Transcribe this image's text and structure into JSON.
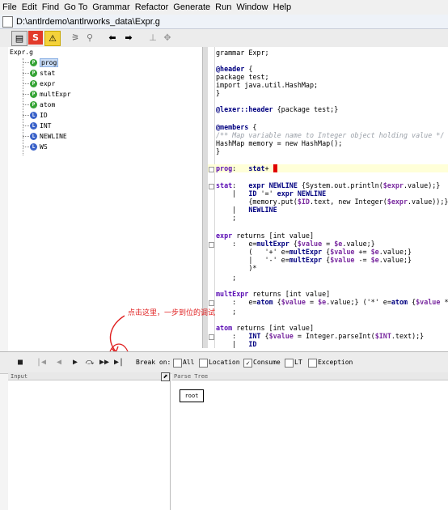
{
  "menu": [
    "File",
    "Edit",
    "Find",
    "Go To",
    "Grammar",
    "Refactor",
    "Generate",
    "Run",
    "Window",
    "Help"
  ],
  "window": {
    "title": "D:\\antlrdemo\\antlrworks_data\\Expr.g"
  },
  "toolbar": {
    "icons": [
      "editor-icon",
      "stop-s-icon",
      "warning-icon",
      "tree-icon",
      "search-icon",
      "back-arrow-icon",
      "forward-arrow-icon",
      "split-icon",
      "split-disabled-icon"
    ]
  },
  "tree": {
    "root": "Expr.g",
    "items": [
      {
        "label": "prog",
        "kind": "P",
        "selected": true
      },
      {
        "label": "stat",
        "kind": "P"
      },
      {
        "label": "expr",
        "kind": "P"
      },
      {
        "label": "multExpr",
        "kind": "P"
      },
      {
        "label": "atom",
        "kind": "P"
      },
      {
        "label": "ID",
        "kind": "L"
      },
      {
        "label": "INT",
        "kind": "L"
      },
      {
        "label": "NEWLINE",
        "kind": "L"
      },
      {
        "label": "WS",
        "kind": "L"
      }
    ]
  },
  "annotation": "点击这里，一步到位的调试",
  "debugger": {
    "break_on": "Break on:",
    "checks": [
      {
        "label": "All",
        "checked": false
      },
      {
        "label": "Location",
        "checked": false
      },
      {
        "label": "Consume",
        "checked": true
      },
      {
        "label": "LT",
        "checked": false
      },
      {
        "label": "Exception",
        "checked": false
      }
    ]
  },
  "panels": {
    "input": "Input",
    "parse_tree": "Parse Tree",
    "root_node": "root"
  },
  "colors": {
    "keyword": "#000080",
    "rule": "#5a0cb4",
    "var": "#7a2ba0",
    "comment": "#9aa0a8",
    "annotation": "#e02020",
    "current_line": "#ffffd8"
  }
}
